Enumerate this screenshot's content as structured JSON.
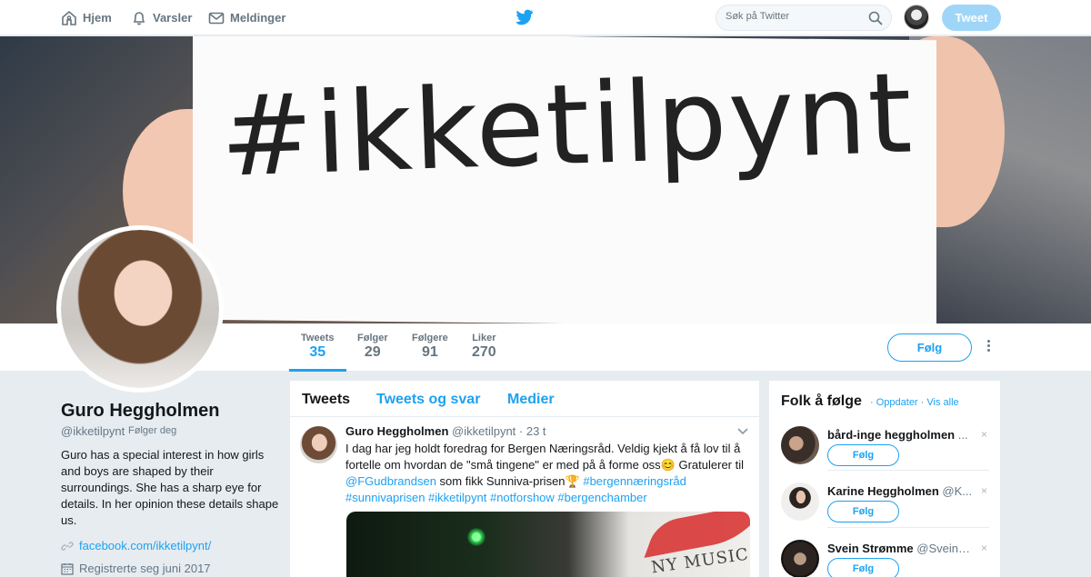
{
  "nav": {
    "home": "Hjem",
    "notifications": "Varsler",
    "messages": "Meldinger",
    "search_placeholder": "Søk på Twitter",
    "tweet_button": "Tweet"
  },
  "banner": {
    "slogan": "#ikketilpynt"
  },
  "stats": [
    {
      "label": "Tweets",
      "value": "35"
    },
    {
      "label": "Følger",
      "value": "29"
    },
    {
      "label": "Følgere",
      "value": "91"
    },
    {
      "label": "Liker",
      "value": "270"
    }
  ],
  "follow_button": "Følg",
  "profile": {
    "name": "Guro Heggholmen",
    "handle": "@ikketilpynt",
    "follows_you": "Følger deg",
    "bio": "Guro has a special interest in how girls and boys are shaped by their surroundings. She has a sharp eye for details. In her opinion these details shape us.",
    "link": "facebook.com/ikketilpynt/",
    "joined": "Registrerte seg juni 2017"
  },
  "timeline": {
    "tabs": [
      "Tweets",
      "Tweets og svar",
      "Medier"
    ],
    "tweet": {
      "name": "Guro Heggholmen",
      "handle": "@ikketilpynt",
      "time": "· 23 t",
      "text": "I  dag har jeg holdt foredrag for Bergen Næringsråd. Veldig kjekt å få  lov  til å fortelle om hvordan de \"små tingene\" er med på å forme oss😊 Gratulerer til ",
      "mention": "@FGudbrandsen",
      "text2": " som fikk Sunniva-prisen🏆  ",
      "hashtag1": "#bergennæringsråd",
      "hashtags2": "#sunnivaprisen #ikketilpynt #notforshow #bergenchamber",
      "media_caption": "NY MUSIC"
    }
  },
  "who_to_follow": {
    "title": "Folk å følge",
    "refresh": "Oppdater",
    "view_all": "Vis alle",
    "close": "×",
    "suggestions": [
      {
        "name": "bård-inge heggholmen",
        "handle": "..."
      },
      {
        "name": "Karine Heggholmen",
        "handle": "@K..."
      },
      {
        "name": "Svein Strømme",
        "handle": "@SveinM..."
      }
    ]
  },
  "colors": {
    "accent": "#1da1f2",
    "background": "#e6ecf0",
    "tweet_button": "#9fd6f8"
  }
}
